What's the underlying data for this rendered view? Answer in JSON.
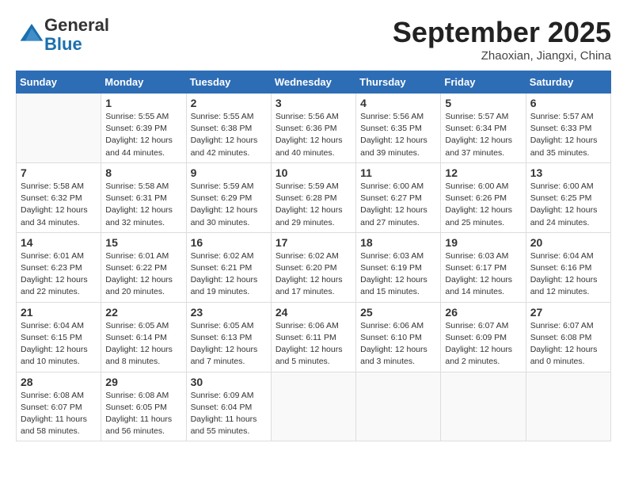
{
  "header": {
    "logo_general": "General",
    "logo_blue": "Blue",
    "month": "September 2025",
    "location": "Zhaoxian, Jiangxi, China"
  },
  "days_of_week": [
    "Sunday",
    "Monday",
    "Tuesday",
    "Wednesday",
    "Thursday",
    "Friday",
    "Saturday"
  ],
  "weeks": [
    [
      {
        "day": "",
        "detail": ""
      },
      {
        "day": "1",
        "detail": "Sunrise: 5:55 AM\nSunset: 6:39 PM\nDaylight: 12 hours\nand 44 minutes."
      },
      {
        "day": "2",
        "detail": "Sunrise: 5:55 AM\nSunset: 6:38 PM\nDaylight: 12 hours\nand 42 minutes."
      },
      {
        "day": "3",
        "detail": "Sunrise: 5:56 AM\nSunset: 6:36 PM\nDaylight: 12 hours\nand 40 minutes."
      },
      {
        "day": "4",
        "detail": "Sunrise: 5:56 AM\nSunset: 6:35 PM\nDaylight: 12 hours\nand 39 minutes."
      },
      {
        "day": "5",
        "detail": "Sunrise: 5:57 AM\nSunset: 6:34 PM\nDaylight: 12 hours\nand 37 minutes."
      },
      {
        "day": "6",
        "detail": "Sunrise: 5:57 AM\nSunset: 6:33 PM\nDaylight: 12 hours\nand 35 minutes."
      }
    ],
    [
      {
        "day": "7",
        "detail": "Sunrise: 5:58 AM\nSunset: 6:32 PM\nDaylight: 12 hours\nand 34 minutes."
      },
      {
        "day": "8",
        "detail": "Sunrise: 5:58 AM\nSunset: 6:31 PM\nDaylight: 12 hours\nand 32 minutes."
      },
      {
        "day": "9",
        "detail": "Sunrise: 5:59 AM\nSunset: 6:29 PM\nDaylight: 12 hours\nand 30 minutes."
      },
      {
        "day": "10",
        "detail": "Sunrise: 5:59 AM\nSunset: 6:28 PM\nDaylight: 12 hours\nand 29 minutes."
      },
      {
        "day": "11",
        "detail": "Sunrise: 6:00 AM\nSunset: 6:27 PM\nDaylight: 12 hours\nand 27 minutes."
      },
      {
        "day": "12",
        "detail": "Sunrise: 6:00 AM\nSunset: 6:26 PM\nDaylight: 12 hours\nand 25 minutes."
      },
      {
        "day": "13",
        "detail": "Sunrise: 6:00 AM\nSunset: 6:25 PM\nDaylight: 12 hours\nand 24 minutes."
      }
    ],
    [
      {
        "day": "14",
        "detail": "Sunrise: 6:01 AM\nSunset: 6:23 PM\nDaylight: 12 hours\nand 22 minutes."
      },
      {
        "day": "15",
        "detail": "Sunrise: 6:01 AM\nSunset: 6:22 PM\nDaylight: 12 hours\nand 20 minutes."
      },
      {
        "day": "16",
        "detail": "Sunrise: 6:02 AM\nSunset: 6:21 PM\nDaylight: 12 hours\nand 19 minutes."
      },
      {
        "day": "17",
        "detail": "Sunrise: 6:02 AM\nSunset: 6:20 PM\nDaylight: 12 hours\nand 17 minutes."
      },
      {
        "day": "18",
        "detail": "Sunrise: 6:03 AM\nSunset: 6:19 PM\nDaylight: 12 hours\nand 15 minutes."
      },
      {
        "day": "19",
        "detail": "Sunrise: 6:03 AM\nSunset: 6:17 PM\nDaylight: 12 hours\nand 14 minutes."
      },
      {
        "day": "20",
        "detail": "Sunrise: 6:04 AM\nSunset: 6:16 PM\nDaylight: 12 hours\nand 12 minutes."
      }
    ],
    [
      {
        "day": "21",
        "detail": "Sunrise: 6:04 AM\nSunset: 6:15 PM\nDaylight: 12 hours\nand 10 minutes."
      },
      {
        "day": "22",
        "detail": "Sunrise: 6:05 AM\nSunset: 6:14 PM\nDaylight: 12 hours\nand 8 minutes."
      },
      {
        "day": "23",
        "detail": "Sunrise: 6:05 AM\nSunset: 6:13 PM\nDaylight: 12 hours\nand 7 minutes."
      },
      {
        "day": "24",
        "detail": "Sunrise: 6:06 AM\nSunset: 6:11 PM\nDaylight: 12 hours\nand 5 minutes."
      },
      {
        "day": "25",
        "detail": "Sunrise: 6:06 AM\nSunset: 6:10 PM\nDaylight: 12 hours\nand 3 minutes."
      },
      {
        "day": "26",
        "detail": "Sunrise: 6:07 AM\nSunset: 6:09 PM\nDaylight: 12 hours\nand 2 minutes."
      },
      {
        "day": "27",
        "detail": "Sunrise: 6:07 AM\nSunset: 6:08 PM\nDaylight: 12 hours\nand 0 minutes."
      }
    ],
    [
      {
        "day": "28",
        "detail": "Sunrise: 6:08 AM\nSunset: 6:07 PM\nDaylight: 11 hours\nand 58 minutes."
      },
      {
        "day": "29",
        "detail": "Sunrise: 6:08 AM\nSunset: 6:05 PM\nDaylight: 11 hours\nand 56 minutes."
      },
      {
        "day": "30",
        "detail": "Sunrise: 6:09 AM\nSunset: 6:04 PM\nDaylight: 11 hours\nand 55 minutes."
      },
      {
        "day": "",
        "detail": ""
      },
      {
        "day": "",
        "detail": ""
      },
      {
        "day": "",
        "detail": ""
      },
      {
        "day": "",
        "detail": ""
      }
    ]
  ]
}
